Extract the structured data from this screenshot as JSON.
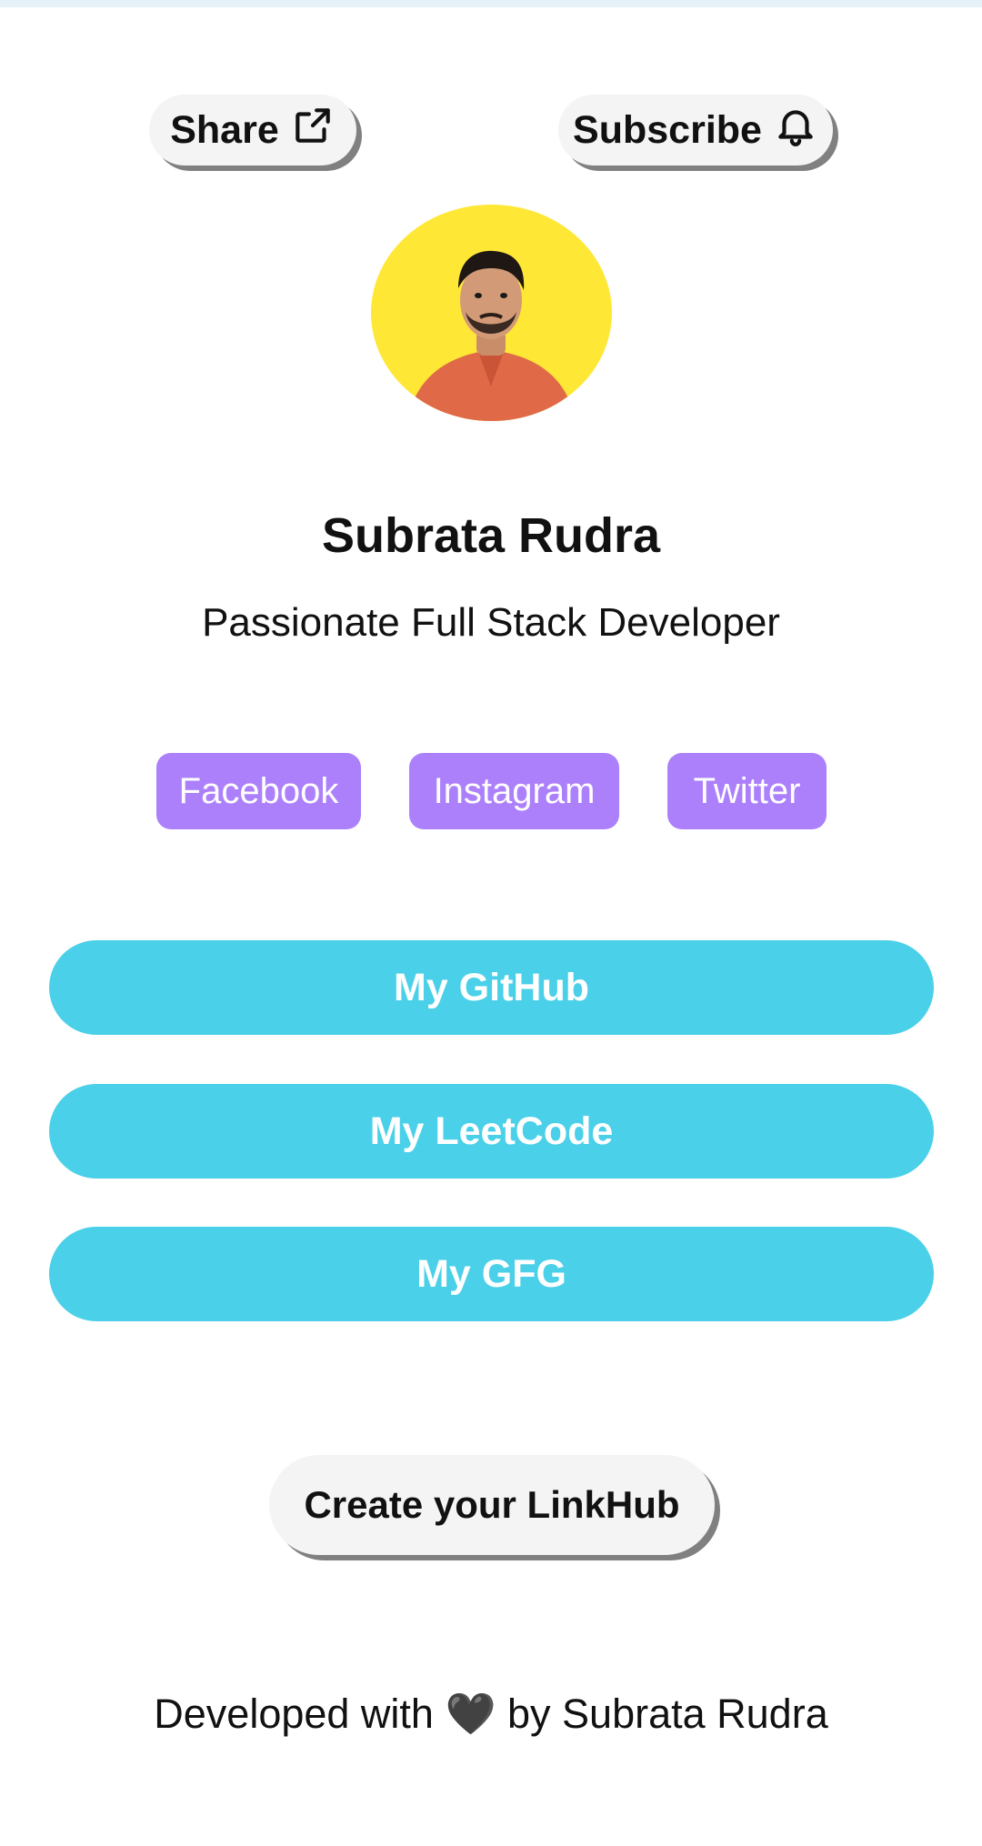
{
  "header": {
    "share_label": "Share",
    "share_icon": "share-icon",
    "subscribe_label": "Subscribe",
    "subscribe_icon": "bell-icon"
  },
  "profile": {
    "name": "Subrata Rudra",
    "tagline": "Passionate Full Stack Developer",
    "avatar_bg": "#ffe736"
  },
  "social_links": [
    {
      "label": "Facebook"
    },
    {
      "label": "Instagram"
    },
    {
      "label": "Twitter"
    }
  ],
  "links": [
    {
      "label": "My GitHub"
    },
    {
      "label": "My LeetCode"
    },
    {
      "label": "My GFG"
    }
  ],
  "cta": {
    "label": "Create your LinkHub"
  },
  "footer": {
    "prefix": "Developed with",
    "heart": "🖤",
    "suffix": "by Subrata Rudra"
  },
  "colors": {
    "social_bg": "#ac80fb",
    "link_bg": "#4ad0e8",
    "pill_bg": "#f4f4f4",
    "shadow": "#808080"
  }
}
